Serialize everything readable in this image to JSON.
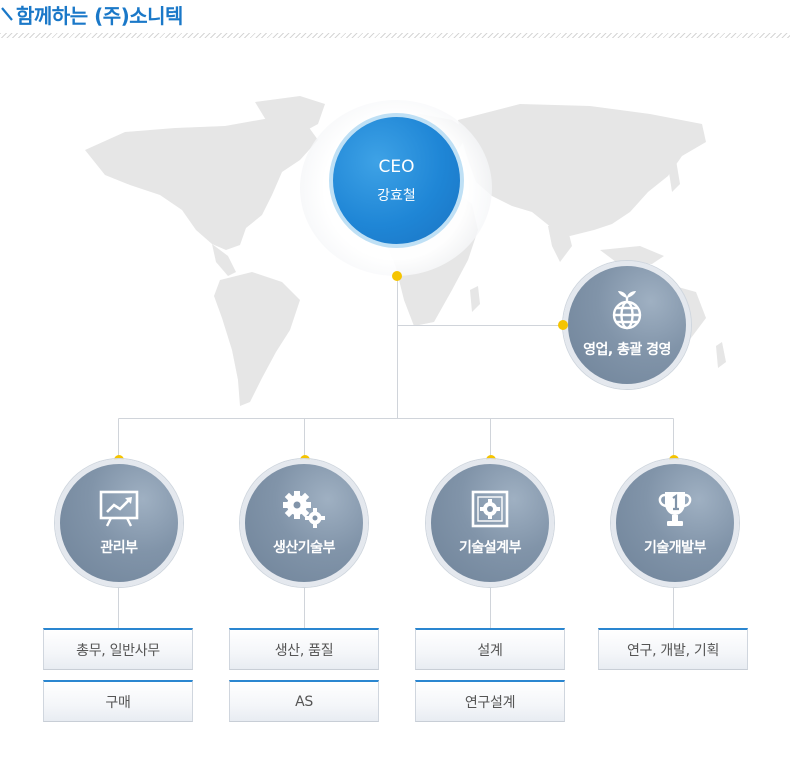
{
  "header": {
    "title": "함께하는 (주)소니텍"
  },
  "ceo": {
    "role": "CEO",
    "name": "강효철"
  },
  "side": {
    "label": "영업, 총괄 경영",
    "icon": "globe-plant-icon"
  },
  "departments": [
    {
      "label": "관리부",
      "icon": "chart-board-icon",
      "tasks": [
        "총무, 일반사무",
        "구매"
      ]
    },
    {
      "label": "생산기술부",
      "icon": "gears-icon",
      "tasks": [
        "생산, 품질",
        "AS"
      ]
    },
    {
      "label": "기술설계부",
      "icon": "blueprint-gear-icon",
      "tasks": [
        "설계",
        "연구설계"
      ]
    },
    {
      "label": "기술개발부",
      "icon": "trophy-icon",
      "tasks": [
        "연구, 개발, 기획"
      ]
    }
  ],
  "colors": {
    "brand": "#1a78c8",
    "connector_dot": "#f5c400",
    "node": "#8194a9"
  }
}
